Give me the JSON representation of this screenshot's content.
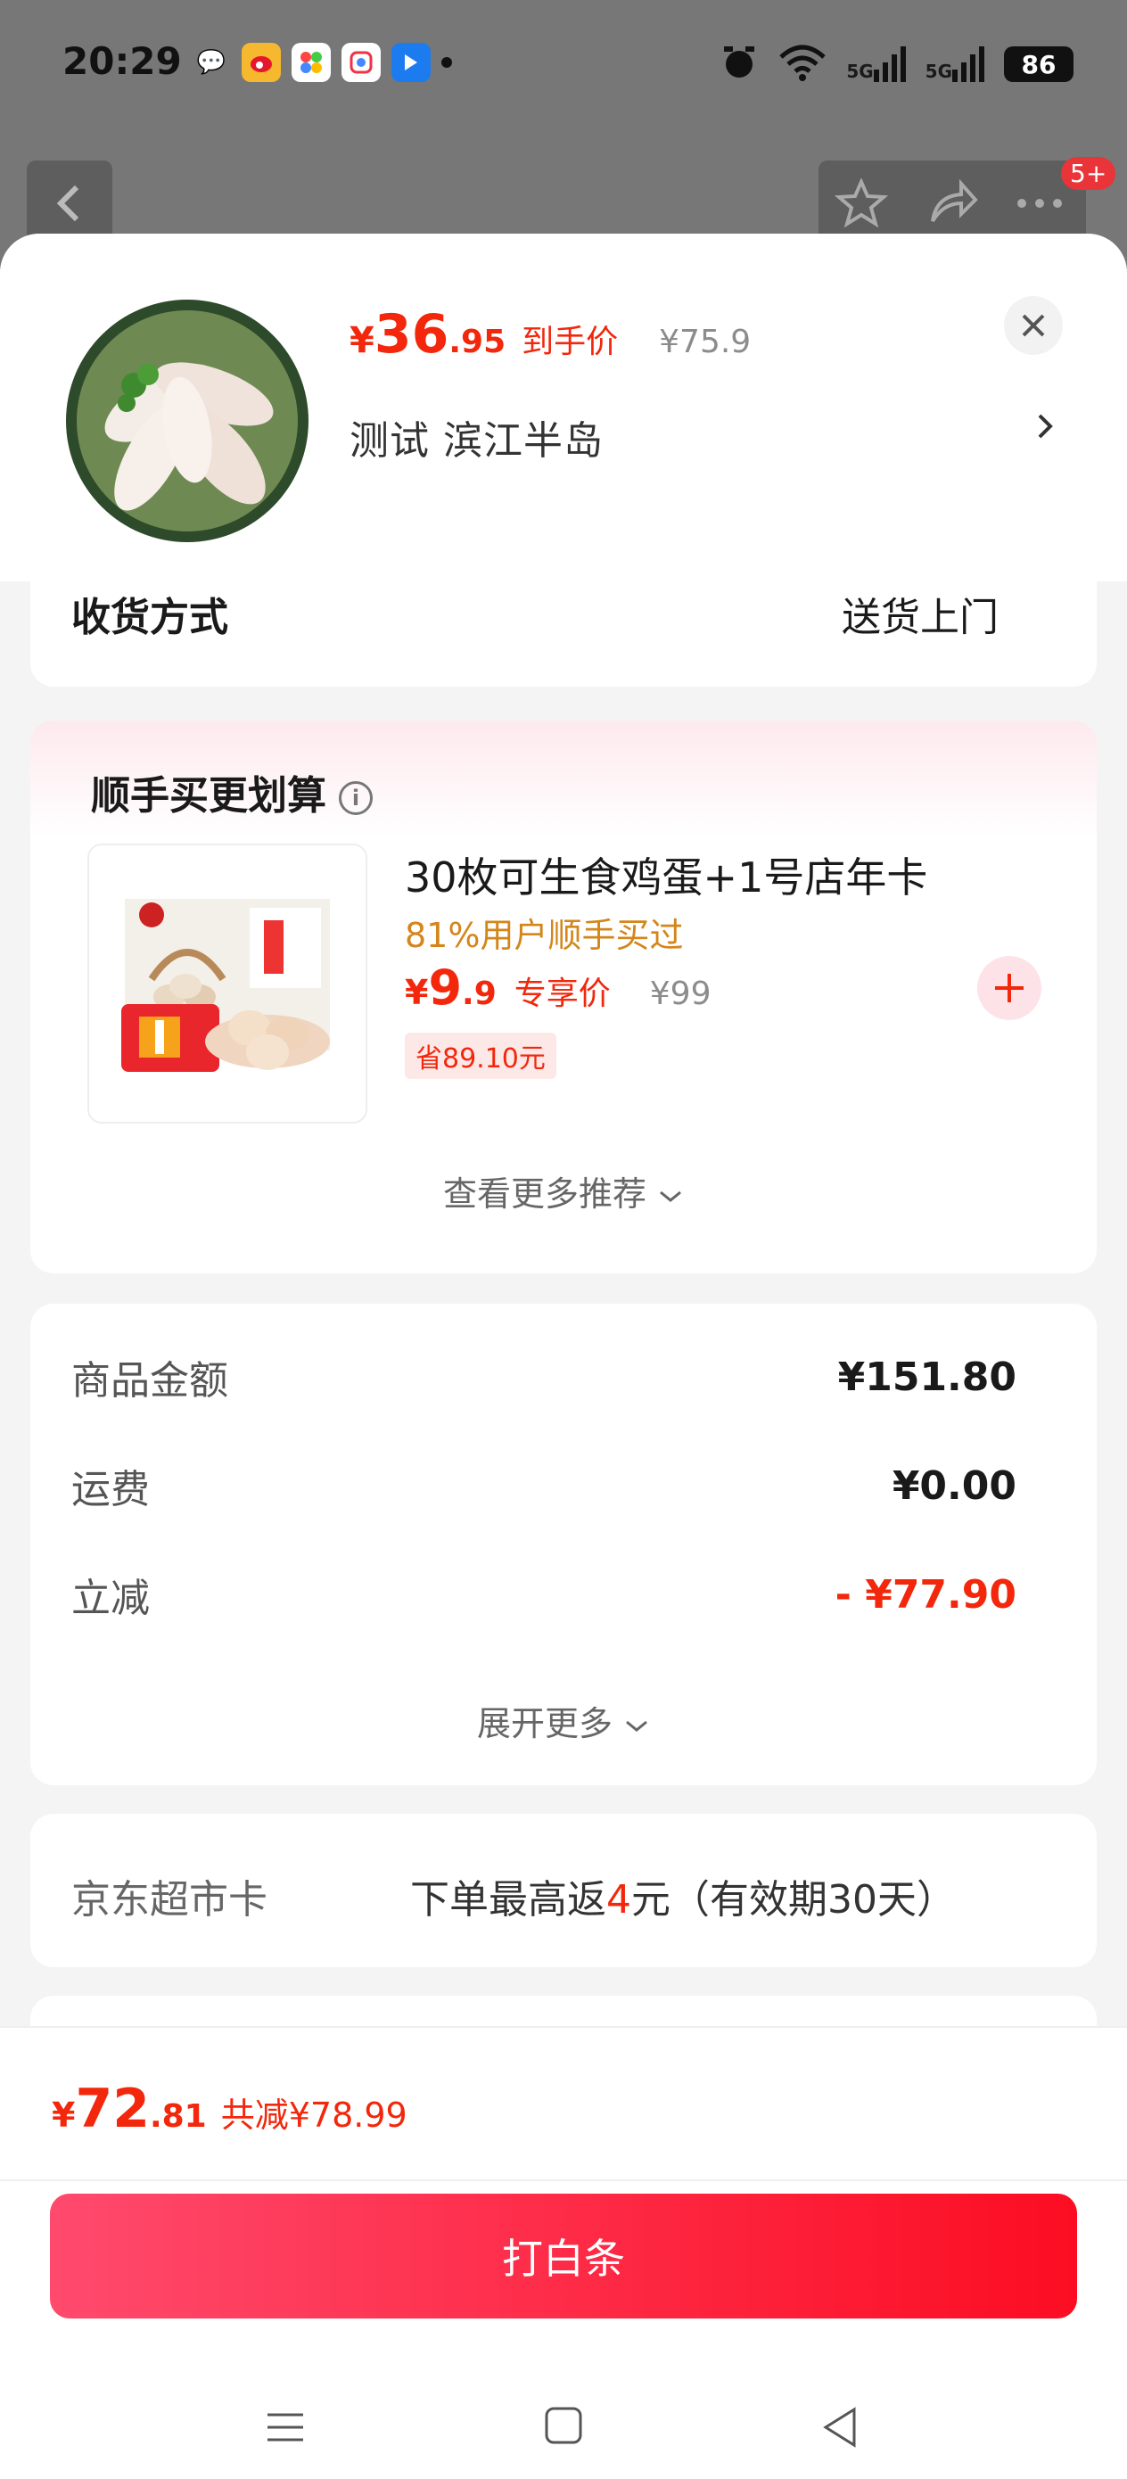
{
  "status_bar": {
    "time": "20:29",
    "signal_1": "5G",
    "signal_2": "5G",
    "battery": "86"
  },
  "header": {
    "badge": "5+"
  },
  "product": {
    "price_yen": "¥",
    "price_int": "36",
    "price_dec": ".95",
    "price_tag": "到手价",
    "original_price": "¥75.9",
    "address": "测试  滨江半岛"
  },
  "shipping": {
    "label": "收货方式",
    "value": "送货上门"
  },
  "recommend": {
    "title": "顺手买更划算",
    "item_name": "30枚可生食鸡蛋+1号店年卡",
    "item_sub": "81%用户顺手买过",
    "item_yen": "¥",
    "item_int": "9",
    "item_dec": ".9",
    "item_tag": "专享价",
    "item_orig": "¥99",
    "item_save": "省89.10元",
    "more": "查看更多推荐"
  },
  "summary": {
    "rows": [
      {
        "label": "商品金额",
        "value": "¥151.80"
      },
      {
        "label": "运费",
        "value": "¥0.00"
      },
      {
        "label": "立减",
        "value": "- ¥77.90"
      }
    ],
    "expand": "展开更多"
  },
  "jd_card": {
    "label": "京东超市卡",
    "text_a": "下单最高返",
    "text_num": "4",
    "text_b": "元（有效期30天）"
  },
  "bottom": {
    "total_yen": "¥",
    "total_int": "72",
    "total_dec": ".81",
    "total_save": "共减¥78.99",
    "pay_button": "打白条"
  },
  "colors": {
    "accent_red": "#f2270c",
    "button_gradient_start": "#ff4a6d",
    "button_gradient_end": "#fc0d22"
  },
  "icons": [
    "back-icon",
    "star-icon",
    "share-icon",
    "more-icon",
    "close-icon",
    "chevron-right-icon",
    "info-icon",
    "plus-icon",
    "chevron-down-icon",
    "menu-icon",
    "home-icon",
    "back-nav-icon"
  ]
}
